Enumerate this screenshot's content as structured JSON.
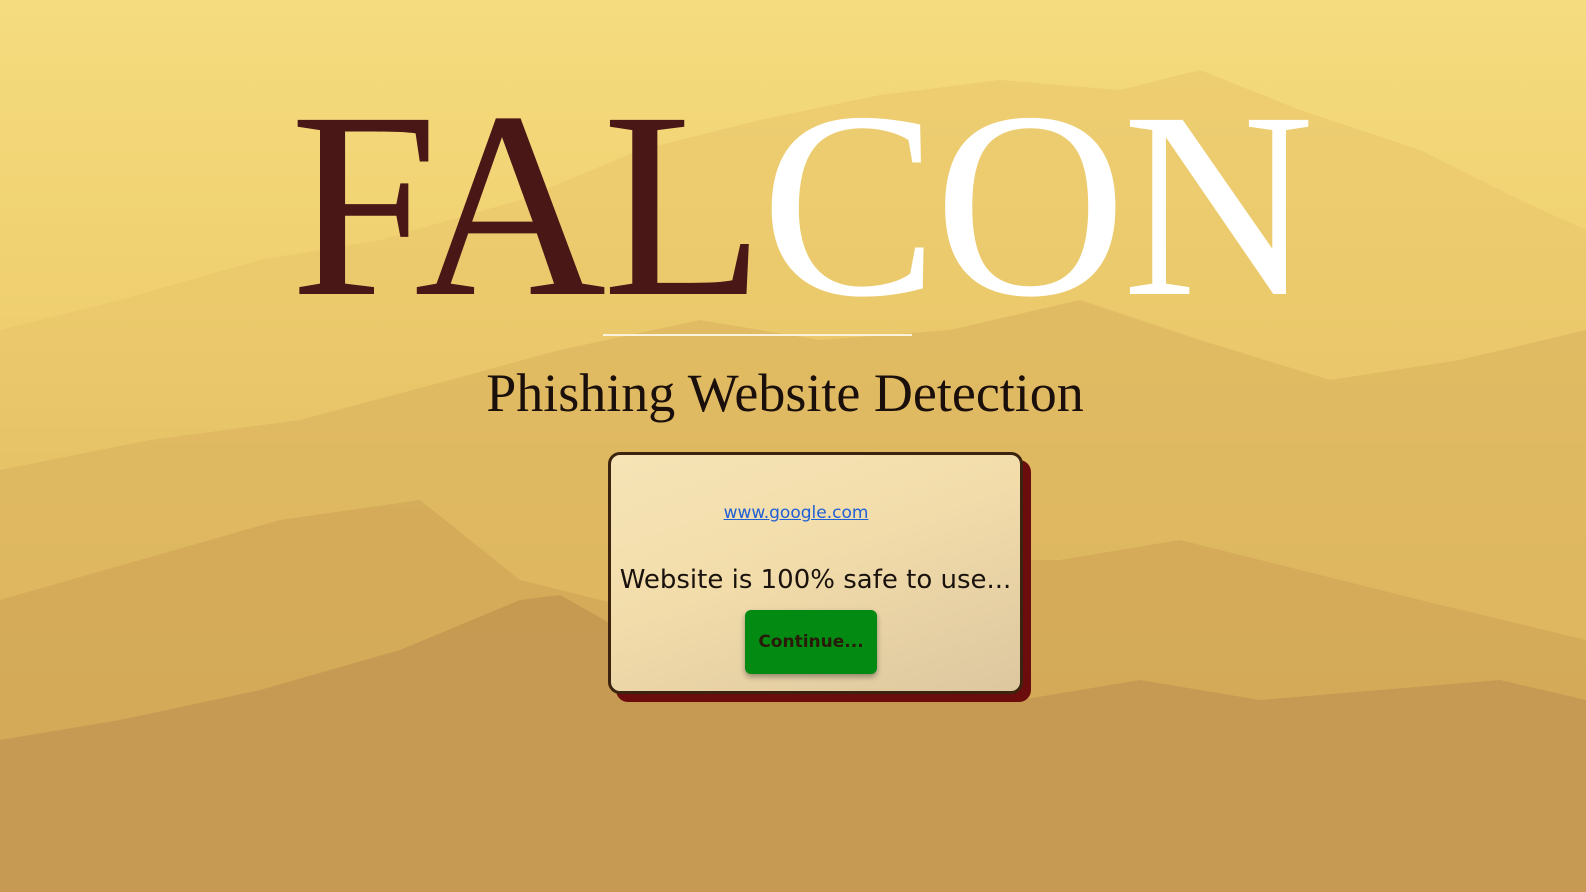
{
  "brand": {
    "logo_part_dark": "FAL",
    "logo_part_light": "CON",
    "subtitle": "Phishing Website Detection"
  },
  "result": {
    "url": "www.google.com",
    "message": "Website is 100% safe to use...",
    "continue_label": "Continue..."
  },
  "colors": {
    "logo_dark": "#4a1717",
    "logo_light": "#ffffff",
    "button_green": "#028a12",
    "card_shadow": "#6b0d0d",
    "link_blue": "#1f5fd6"
  }
}
